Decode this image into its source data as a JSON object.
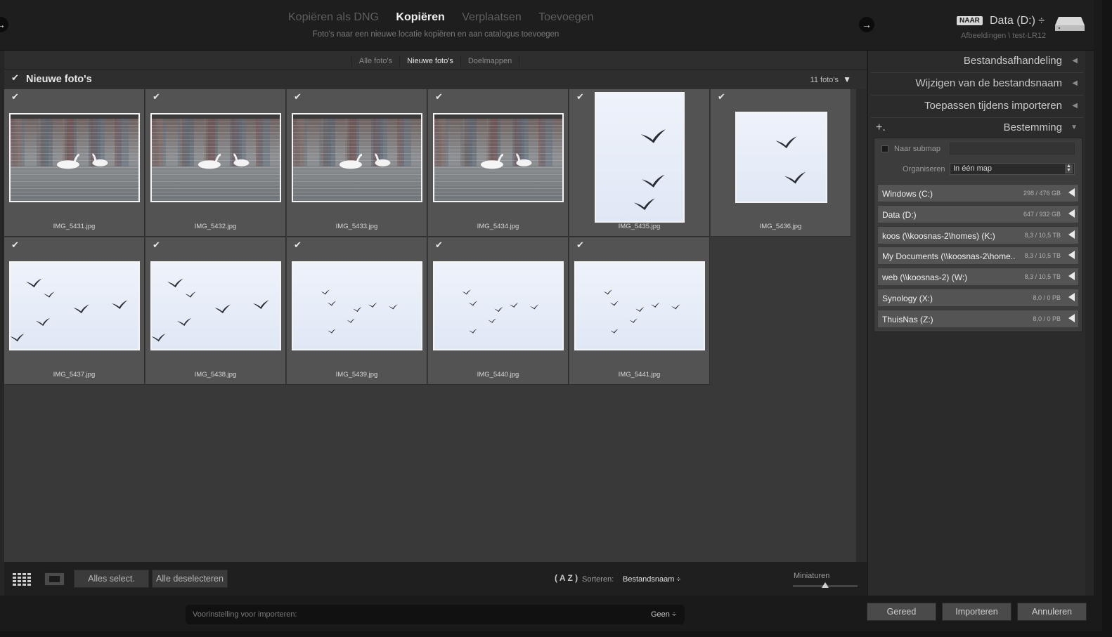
{
  "header": {
    "modes": [
      "Kopiëren als DNG",
      "Kopiëren",
      "Verplaatsen",
      "Toevoegen"
    ],
    "active_mode": "Kopiëren",
    "mode_description": "Foto's naar een nieuwe locatie kopiëren en aan catalogus toevoegen",
    "destination_badge": "NAAR",
    "destination_title": "Data (D:) ÷",
    "destination_path": "Afbeeldingen \\ test-LR12"
  },
  "tabs": [
    "Alle foto's",
    "Nieuwe foto's",
    "Doelmappen"
  ],
  "active_tab": "Nieuwe foto's",
  "grid": {
    "title": "Nieuwe foto's",
    "count": "11 foto's",
    "photos": [
      {
        "filename": "IMG_5431.jpg",
        "subject": "swans-reflection",
        "checked": true
      },
      {
        "filename": "IMG_5432.jpg",
        "subject": "swans-reflection",
        "checked": true
      },
      {
        "filename": "IMG_5433.jpg",
        "subject": "swans-reflection",
        "checked": true
      },
      {
        "filename": "IMG_5434.jpg",
        "subject": "swans-reflection",
        "checked": true
      },
      {
        "filename": "IMG_5435.jpg",
        "subject": "flying-birds-portrait",
        "checked": true
      },
      {
        "filename": "IMG_5436.jpg",
        "subject": "flying-birds-square",
        "checked": true
      },
      {
        "filename": "IMG_5437.jpg",
        "subject": "flying-birds-flock",
        "checked": true
      },
      {
        "filename": "IMG_5438.jpg",
        "subject": "flying-birds-flock",
        "checked": true
      },
      {
        "filename": "IMG_5439.jpg",
        "subject": "flying-birds-distant",
        "checked": true
      },
      {
        "filename": "IMG_5440.jpg",
        "subject": "flying-birds-distant",
        "checked": true
      },
      {
        "filename": "IMG_5441.jpg",
        "subject": "flying-birds-distant-blue",
        "checked": true
      }
    ]
  },
  "toolbar": {
    "select_all": "Alles select.",
    "deselect_all": "Alle deselecteren",
    "sort_icon": "A Z",
    "sort_label": "Sorteren:",
    "sort_value": "Bestandsnaam ÷",
    "thumbnails_label": "Miniaturen",
    "thumbnail_size": 0.5
  },
  "right_panel": {
    "sections": [
      "Bestandsafhandeling",
      "Wijzigen van de bestandsnaam",
      "Toepassen tijdens importeren",
      "Bestemming"
    ],
    "plus_icon": "+.",
    "submap_label": "Naar submap",
    "organize_label": "Organiseren",
    "organize_value": "In één map",
    "volumes": [
      {
        "name": "Windows (C:)",
        "size": "298 / 476 GB"
      },
      {
        "name": "Data (D:)",
        "size": "647 / 932 GB"
      },
      {
        "name": "koos (\\\\koosnas-2\\homes) (K:)",
        "size": "8,3 / 10,5 TB"
      },
      {
        "name": "My Documents (\\\\koosnas-2\\home...",
        "size": "8,3 / 10,5 TB"
      },
      {
        "name": "web (\\\\koosnas-2) (W:)",
        "size": "8,3 / 10,5 TB"
      },
      {
        "name": "Synology (X:)",
        "size": "8,0 / 0 PB"
      },
      {
        "name": "ThuisNas (Z:)",
        "size": "8,0 / 0 PB"
      }
    ]
  },
  "footer": {
    "preset_label": "Voorinstelling voor importeren:",
    "preset_value": "Geen ÷",
    "done": "Gereed",
    "import": "Importeren",
    "cancel": "Annuleren"
  },
  "colors": {
    "sky": "#e8eef8",
    "water": "#8a8f90",
    "panel": "#2b2b2b"
  }
}
